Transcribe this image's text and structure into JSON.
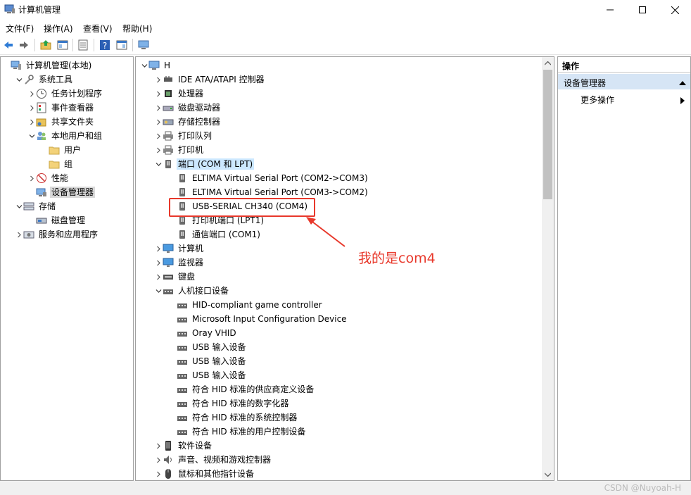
{
  "window": {
    "title": "计算机管理",
    "controls": [
      "minimize",
      "maximize",
      "close"
    ]
  },
  "menu": [
    "文件(F)",
    "操作(A)",
    "查看(V)",
    "帮助(H)"
  ],
  "toolbar": {
    "icons": [
      "back-icon",
      "forward-icon",
      "up-folder-icon",
      "show-hide-tree-icon",
      "export-list-icon",
      "help-icon",
      "properties-icon",
      "computer-icon"
    ]
  },
  "left_tree": [
    {
      "label": "计算机管理(本地)",
      "icon": "computer-management-icon",
      "level": 0,
      "expander": ""
    },
    {
      "label": "系统工具",
      "icon": "tools-icon",
      "level": 1,
      "expander": "down"
    },
    {
      "label": "任务计划程序",
      "icon": "clock-icon",
      "level": 2,
      "expander": "right"
    },
    {
      "label": "事件查看器",
      "icon": "event-viewer-icon",
      "level": 2,
      "expander": "right"
    },
    {
      "label": "共享文件夹",
      "icon": "shared-folder-icon",
      "level": 2,
      "expander": "right"
    },
    {
      "label": "本地用户和组",
      "icon": "users-icon",
      "level": 2,
      "expander": "down"
    },
    {
      "label": "用户",
      "icon": "folder-icon",
      "level": 3,
      "expander": ""
    },
    {
      "label": "组",
      "icon": "folder-icon",
      "level": 3,
      "expander": ""
    },
    {
      "label": "性能",
      "icon": "performance-icon",
      "level": 2,
      "expander": "right"
    },
    {
      "label": "设备管理器",
      "icon": "device-manager-icon",
      "level": 2,
      "expander": "",
      "selected": true
    },
    {
      "label": "存储",
      "icon": "storage-icon",
      "level": 1,
      "expander": "down"
    },
    {
      "label": "磁盘管理",
      "icon": "disk-management-icon",
      "level": 2,
      "expander": ""
    },
    {
      "label": "服务和应用程序",
      "icon": "services-icon",
      "level": 1,
      "expander": "right"
    }
  ],
  "device_tree": [
    {
      "label": "H",
      "icon": "computer-icon",
      "level": 0,
      "expander": "down"
    },
    {
      "label": "IDE ATA/ATAPI 控制器",
      "icon": "ide-controller-icon",
      "level": 1,
      "expander": "right"
    },
    {
      "label": "处理器",
      "icon": "processor-icon",
      "level": 1,
      "expander": "right"
    },
    {
      "label": "磁盘驱动器",
      "icon": "disk-drive-icon",
      "level": 1,
      "expander": "right"
    },
    {
      "label": "存储控制器",
      "icon": "storage-controller-icon",
      "level": 1,
      "expander": "right"
    },
    {
      "label": "打印队列",
      "icon": "printer-icon",
      "level": 1,
      "expander": "right"
    },
    {
      "label": "打印机",
      "icon": "printer-icon",
      "level": 1,
      "expander": "right"
    },
    {
      "label": "端口 (COM 和 LPT)",
      "icon": "port-icon",
      "level": 1,
      "expander": "down",
      "selected": true
    },
    {
      "label": "ELTIMA Virtual Serial Port (COM2->COM3)",
      "icon": "port-icon",
      "level": 2,
      "expander": ""
    },
    {
      "label": "ELTIMA Virtual Serial Port (COM3->COM2)",
      "icon": "port-icon",
      "level": 2,
      "expander": ""
    },
    {
      "label": "USB-SERIAL CH340 (COM4)",
      "icon": "port-icon",
      "level": 2,
      "expander": ""
    },
    {
      "label": "打印机端口 (LPT1)",
      "icon": "port-icon",
      "level": 2,
      "expander": ""
    },
    {
      "label": "通信端口 (COM1)",
      "icon": "port-icon",
      "level": 2,
      "expander": ""
    },
    {
      "label": "计算机",
      "icon": "monitor-icon",
      "level": 1,
      "expander": "right"
    },
    {
      "label": "监视器",
      "icon": "monitor-icon",
      "level": 1,
      "expander": "right"
    },
    {
      "label": "键盘",
      "icon": "keyboard-icon",
      "level": 1,
      "expander": "right"
    },
    {
      "label": "人机接口设备",
      "icon": "hid-icon",
      "level": 1,
      "expander": "down"
    },
    {
      "label": "HID-compliant game controller",
      "icon": "hid-icon",
      "level": 2,
      "expander": ""
    },
    {
      "label": "Microsoft Input Configuration Device",
      "icon": "hid-icon",
      "level": 2,
      "expander": ""
    },
    {
      "label": "Oray VHID",
      "icon": "hid-icon",
      "level": 2,
      "expander": ""
    },
    {
      "label": "USB 输入设备",
      "icon": "hid-icon",
      "level": 2,
      "expander": ""
    },
    {
      "label": "USB 输入设备",
      "icon": "hid-icon",
      "level": 2,
      "expander": ""
    },
    {
      "label": "USB 输入设备",
      "icon": "hid-icon",
      "level": 2,
      "expander": ""
    },
    {
      "label": "符合 HID 标准的供应商定义设备",
      "icon": "hid-icon",
      "level": 2,
      "expander": ""
    },
    {
      "label": "符合 HID 标准的数字化器",
      "icon": "hid-icon",
      "level": 2,
      "expander": ""
    },
    {
      "label": "符合 HID 标准的系统控制器",
      "icon": "hid-icon",
      "level": 2,
      "expander": ""
    },
    {
      "label": "符合 HID 标准的用户控制设备",
      "icon": "hid-icon",
      "level": 2,
      "expander": ""
    },
    {
      "label": "软件设备",
      "icon": "software-device-icon",
      "level": 1,
      "expander": "right"
    },
    {
      "label": "声音、视频和游戏控制器",
      "icon": "sound-icon",
      "level": 1,
      "expander": "right"
    },
    {
      "label": "鼠标和其他指针设备",
      "icon": "mouse-icon",
      "level": 1,
      "expander": "right"
    }
  ],
  "actions": {
    "header": "操作",
    "section": "设备管理器",
    "item": "更多操作"
  },
  "annotation": {
    "text": "我的是com4",
    "color": "#e8382b"
  },
  "watermark": "CSDN @Nuyoah-H",
  "colors": {
    "selected_bg": "#cce8ff",
    "action_section_bg": "#d6e5f5",
    "annotation": "#e8382b"
  }
}
